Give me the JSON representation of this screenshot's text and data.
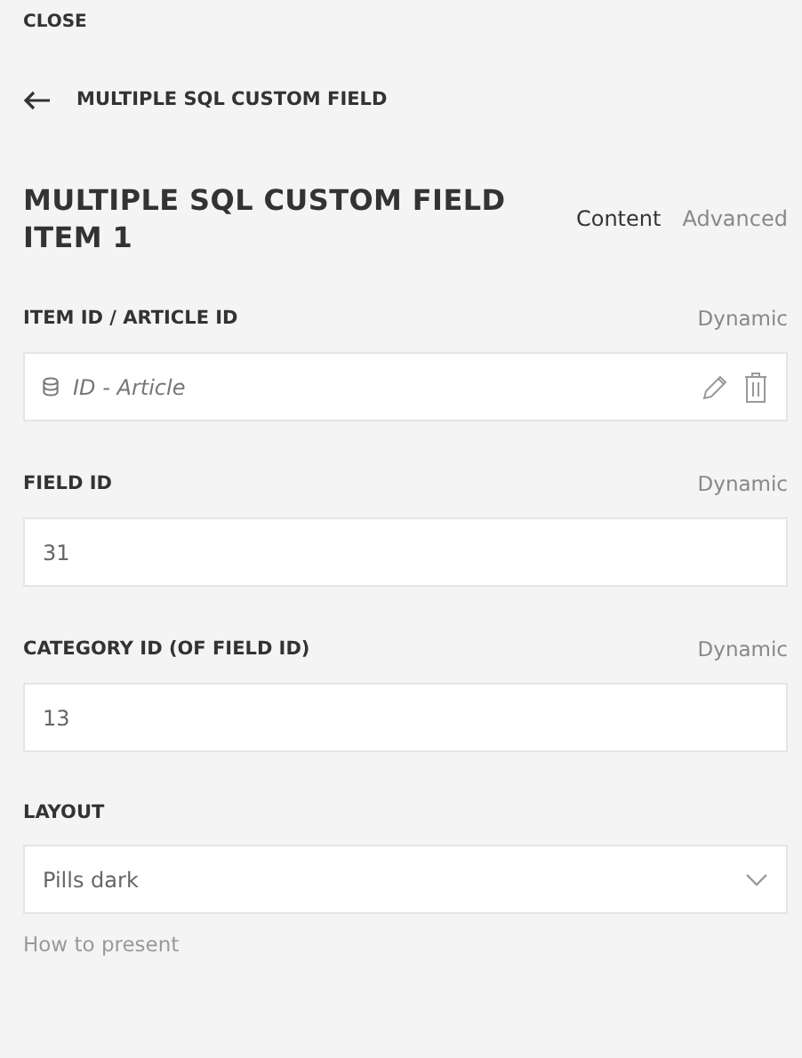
{
  "close": "CLOSE",
  "breadcrumb": {
    "label": "MULTIPLE SQL CUSTOM FIELD"
  },
  "title": "MULTIPLE SQL CUSTOM FIELD ITEM 1",
  "tabs": [
    {
      "label": "Content",
      "selected": true
    },
    {
      "label": "Advanced",
      "selected": false
    }
  ],
  "fields": [
    {
      "kind": "source",
      "label": "ITEM ID / ARTICLE ID",
      "dynamic": "Dynamic",
      "value": "ID - Article"
    },
    {
      "kind": "text",
      "label": "FIELD ID",
      "dynamic": "Dynamic",
      "value": "31"
    },
    {
      "kind": "text",
      "label": "CATEGORY ID (OF FIELD ID)",
      "dynamic": "Dynamic",
      "value": "13"
    },
    {
      "kind": "select",
      "label": "LAYOUT",
      "value": "Pills dark",
      "help": "How to present"
    }
  ]
}
